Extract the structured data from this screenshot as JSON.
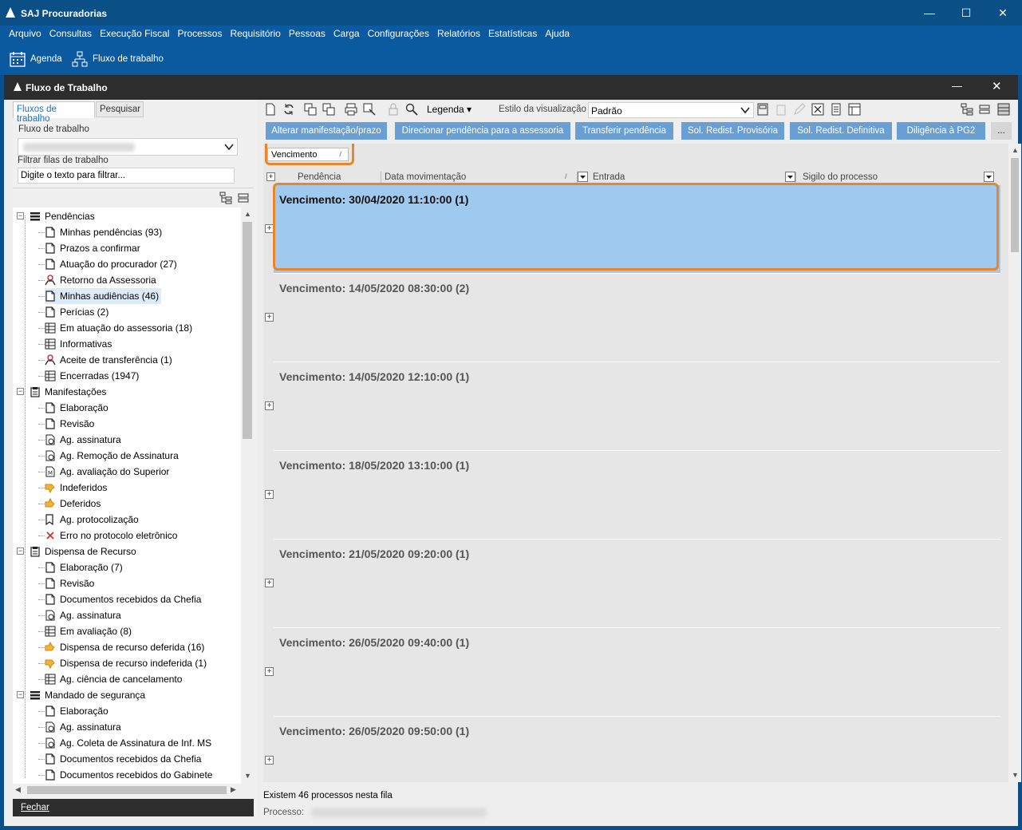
{
  "app": {
    "title": "SAJ Procuradorias"
  },
  "window_controls": {
    "minimize": "—",
    "maximize": "☐",
    "close": "✕"
  },
  "menu": [
    "Arquivo",
    "Consultas",
    "Execução Fiscal",
    "Processos",
    "Requisitório",
    "Pessoas",
    "Carga",
    "Configurações",
    "Relatórios",
    "Estatísticas",
    "Ajuda"
  ],
  "toolbar": {
    "agenda": "Agenda",
    "fluxo": "Fluxo de trabalho"
  },
  "inner_window": {
    "title": "Fluxo de Trabalho",
    "minimize": "—",
    "close": "✕"
  },
  "left": {
    "tabs": [
      "Fluxos de trabalho",
      "Pesquisar"
    ],
    "flow_label": "Fluxo de trabalho",
    "filter_label": "Filtrar filas de trabalho",
    "filter_placeholder": "Digite o texto para filtrar...",
    "close_button": "Fechar"
  },
  "tree": [
    {
      "label": "Pendências",
      "level": 0,
      "icon": "list-icon"
    },
    {
      "label": "Minhas pendências (93)",
      "level": 1,
      "icon": "document-icon"
    },
    {
      "label": "Prazos a confirmar",
      "level": 1,
      "icon": "document-icon"
    },
    {
      "label": "Atuação do procurador (27)",
      "level": 1,
      "icon": "document-icon"
    },
    {
      "label": "Retorno da Assessoria",
      "level": 1,
      "icon": "user-icon"
    },
    {
      "label": "Minhas audiências (46)",
      "level": 1,
      "icon": "document-icon",
      "selected": true
    },
    {
      "label": "Perícias (2)",
      "level": 1,
      "icon": "document-icon"
    },
    {
      "label": "Em atuação do assessoria (18)",
      "level": 1,
      "icon": "grid-icon"
    },
    {
      "label": "Informativas",
      "level": 1,
      "icon": "grid-icon"
    },
    {
      "label": "Aceite de transferência (1)",
      "level": 1,
      "icon": "user-icon"
    },
    {
      "label": "Encerradas (1947)",
      "level": 1,
      "icon": "grid-icon"
    },
    {
      "label": "Manifestações",
      "level": 0,
      "icon": "clipboard-icon"
    },
    {
      "label": "Elaboração",
      "level": 1,
      "icon": "document-icon"
    },
    {
      "label": "Revisão",
      "level": 1,
      "icon": "document-icon"
    },
    {
      "label": "Ag. assinatura",
      "level": 1,
      "icon": "seal-icon"
    },
    {
      "label": "Ag. Remoção de Assinatura",
      "level": 1,
      "icon": "seal-icon"
    },
    {
      "label": "Ag. avaliação do Superior",
      "level": 1,
      "icon": "doc-star-icon"
    },
    {
      "label": "Indeferidos",
      "level": 1,
      "icon": "thumb-down-icon"
    },
    {
      "label": "Deferidos",
      "level": 1,
      "icon": "thumb-up-icon"
    },
    {
      "label": "Ag. protocolização",
      "level": 1,
      "icon": "stamp-icon"
    },
    {
      "label": "Erro no protocolo eletrônico",
      "level": 1,
      "icon": "error-x-icon"
    },
    {
      "label": "Dispensa de Recurso",
      "level": 0,
      "icon": "clipboard-icon"
    },
    {
      "label": "Elaboração (7)",
      "level": 1,
      "icon": "document-icon"
    },
    {
      "label": "Revisão",
      "level": 1,
      "icon": "document-icon"
    },
    {
      "label": "Documentos recebidos da Chefia",
      "level": 1,
      "icon": "document-icon"
    },
    {
      "label": "Ag. assinatura",
      "level": 1,
      "icon": "seal-icon"
    },
    {
      "label": "Em avaliação (8)",
      "level": 1,
      "icon": "grid-icon"
    },
    {
      "label": "Dispensa de recurso deferida (16)",
      "level": 1,
      "icon": "thumb-up-icon"
    },
    {
      "label": "Dispensa de recurso indeferida (1)",
      "level": 1,
      "icon": "thumb-down-icon"
    },
    {
      "label": "Ag. ciência de cancelamento",
      "level": 1,
      "icon": "grid-icon"
    },
    {
      "label": "Mandado de segurança",
      "level": 0,
      "icon": "list-icon"
    },
    {
      "label": "Elaboração",
      "level": 1,
      "icon": "document-icon"
    },
    {
      "label": "Ag. assinatura",
      "level": 1,
      "icon": "seal-icon"
    },
    {
      "label": "Ag. Coleta de Assinatura de Inf. MS",
      "level": 1,
      "icon": "seal-icon"
    },
    {
      "label": "Documentos recebidos da Chefia",
      "level": 1,
      "icon": "document-icon"
    },
    {
      "label": "Documentos recebidos do Gabinete",
      "level": 1,
      "icon": "document-icon"
    }
  ],
  "right_toolbar": {
    "legend": "Legenda ▾",
    "view_style_label": "Estilo da visualização",
    "view_style_value": "Padrão"
  },
  "actions": [
    "Alterar manifestação/prazo",
    "Direcionar pendência para a assessoria",
    "Transferir pendência",
    "Sol. Redist. Provisória",
    "Sol. Redist. Definitiva",
    "Diligência à PG2",
    "..."
  ],
  "grid": {
    "group_by": "Vencimento",
    "group_sort": "/",
    "columns": [
      "Pendência",
      "Data movimentação",
      "Entrada",
      "Sigilo do processo"
    ],
    "groups": [
      {
        "label": "Vencimento: 30/04/2020 11:10:00  (1)",
        "selected": true
      },
      {
        "label": "Vencimento: 14/05/2020 08:30:00  (2)"
      },
      {
        "label": "Vencimento: 14/05/2020 12:10:00  (1)"
      },
      {
        "label": "Vencimento: 18/05/2020 13:10:00  (1)"
      },
      {
        "label": "Vencimento: 21/05/2020 09:20:00  (1)"
      },
      {
        "label": "Vencimento: 26/05/2020 09:40:00  (1)"
      },
      {
        "label": "Vencimento: 26/05/2020 09:50:00  (1)"
      }
    ]
  },
  "status": {
    "count": "Existem 46 processos nesta fila",
    "process_label": "Processo:"
  },
  "colors": {
    "titlebar": "#0b4f87",
    "menubar": "#0b5aa0",
    "action_button": "#6a9fd4",
    "selected_group": "#9fc9ef",
    "highlight": "#e8862b"
  }
}
